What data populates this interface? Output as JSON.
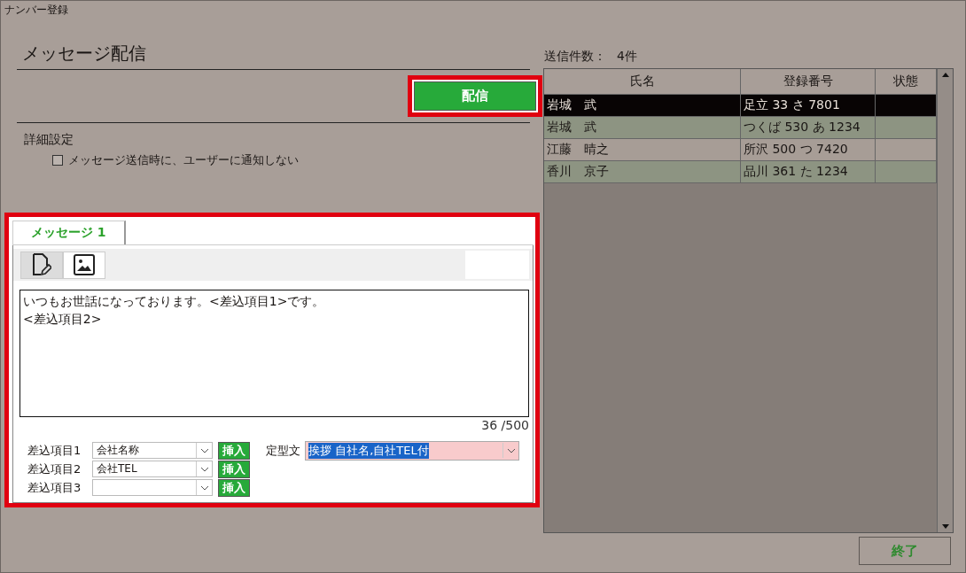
{
  "window": {
    "title": "ナンバー登録"
  },
  "message_panel": {
    "heading": "メッセージ配信",
    "send_button": "配信",
    "details_heading": "詳細設定",
    "notify_option": {
      "label": "メッセージ送信時に、ユーザーに通知しない",
      "checked": false
    },
    "tabs": [
      {
        "label": "メッセージ 1",
        "selected": true
      }
    ],
    "editor_modes": [
      {
        "kind": "text",
        "selected": true
      },
      {
        "kind": "image",
        "selected": false
      }
    ],
    "message_text": "いつもお世話になっております。<差込項目1>です。\n<差込項目2>",
    "char_count": "36 /500",
    "merge_fields": [
      {
        "label": "差込項目1",
        "value": "会社名称",
        "insert_button": "挿入"
      },
      {
        "label": "差込項目2",
        "value": "会社TEL",
        "insert_button": "挿入"
      },
      {
        "label": "差込項目3",
        "insert_button": "挿入"
      }
    ],
    "template": {
      "label": "定型文",
      "value": "挨拶 自社名,自社TEL付"
    }
  },
  "recipients": {
    "count_label": "送信件数：",
    "count": "4件",
    "columns": [
      "氏名",
      "登録番号",
      "状態"
    ],
    "rows": [
      {
        "name": "岩城　武",
        "number": "足立 33 さ 7801",
        "selected": true
      },
      {
        "name": "岩城　武",
        "number": "つくば 530 あ 1234",
        "selected": false
      },
      {
        "name": "江藤　晴之",
        "number": "所沢 500 つ 7420",
        "selected": false
      },
      {
        "name": "香川　京子",
        "number": "品川 361 た 1234",
        "selected": false
      }
    ]
  },
  "close_button": "終了"
}
